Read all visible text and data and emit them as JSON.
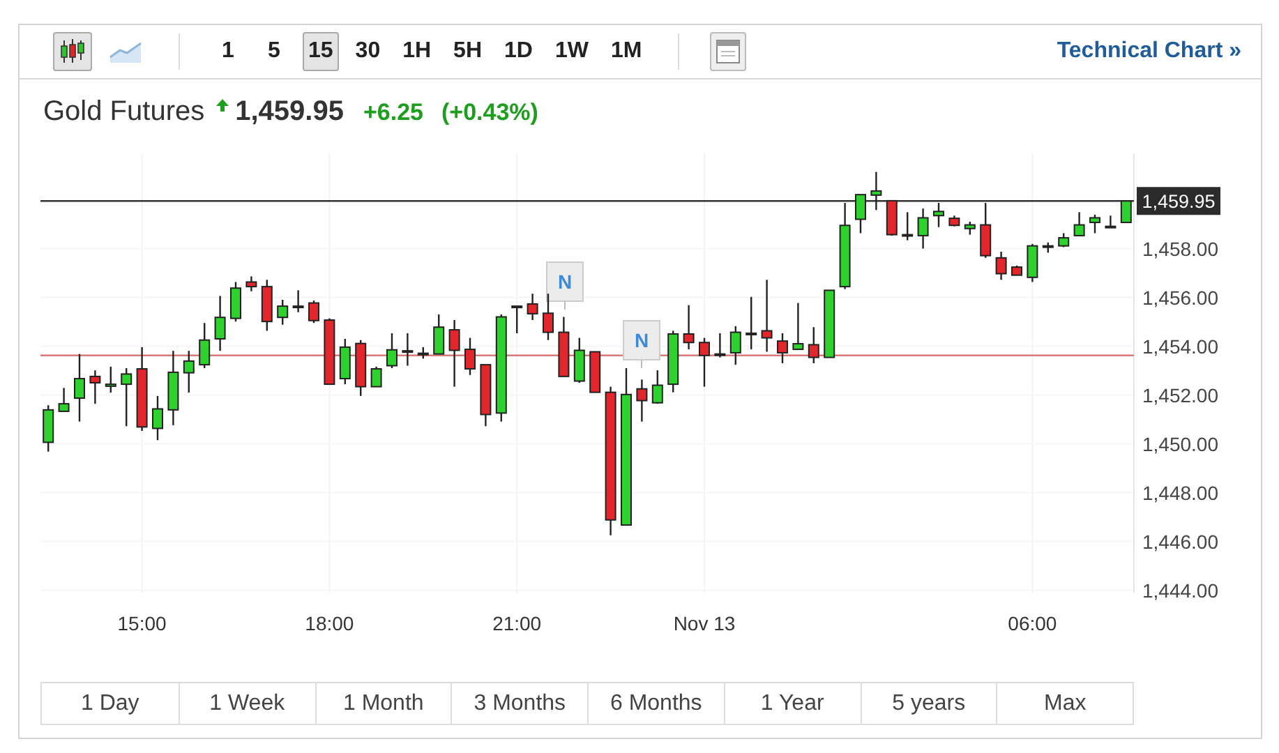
{
  "toolbar": {
    "chart_types": [
      {
        "kind": "candles",
        "selected": true
      },
      {
        "kind": "line",
        "selected": false
      }
    ],
    "intervals": [
      {
        "label": "1",
        "selected": false
      },
      {
        "label": "5",
        "selected": false
      },
      {
        "label": "15",
        "selected": true
      },
      {
        "label": "30",
        "selected": false
      },
      {
        "label": "1H",
        "selected": false
      },
      {
        "label": "5H",
        "selected": false
      },
      {
        "label": "1D",
        "selected": false
      },
      {
        "label": "1W",
        "selected": false
      },
      {
        "label": "1M",
        "selected": false
      }
    ],
    "link": "Technical Chart »"
  },
  "quote": {
    "name": "Gold Futures",
    "rising": true,
    "price": "1,459.95",
    "change": "+6.25",
    "change_pct": "(+0.43%)"
  },
  "chart": {
    "chart_data": {
      "type": "candlestick",
      "ylim": [
        1443.9,
        1461.9
      ],
      "categories": [
        null,
        null,
        null,
        null,
        null,
        null,
        "15:00",
        null,
        null,
        null,
        null,
        null,
        null,
        null,
        null,
        null,
        null,
        null,
        "18:00",
        null,
        null,
        null,
        null,
        null,
        null,
        null,
        null,
        null,
        null,
        null,
        "21:00",
        null,
        null,
        null,
        null,
        null,
        null,
        null,
        null,
        null,
        null,
        null,
        "Nov 13",
        null,
        null,
        null,
        null,
        null,
        null,
        null,
        null,
        null,
        null,
        null,
        null,
        null,
        null,
        null,
        null,
        null,
        null,
        null,
        null,
        "06:00",
        null,
        null,
        null,
        null,
        null,
        null
      ],
      "yticks": [
        {
          "value": 1444,
          "label": "1,444.00"
        },
        {
          "value": 1446,
          "label": "1,446.00"
        },
        {
          "value": 1448,
          "label": "1,448.00"
        },
        {
          "value": 1450,
          "label": "1,450.00"
        },
        {
          "value": 1452,
          "label": "1,452.00"
        },
        {
          "value": 1454,
          "label": "1,454.00"
        },
        {
          "value": 1456,
          "label": "1,456.00"
        },
        {
          "value": 1458,
          "label": "1,458.00"
        }
      ],
      "ohlc": [
        [
          1450.06,
          1451.58,
          1449.68,
          1451.39
        ],
        [
          1451.33,
          1452.29,
          1451.3,
          1451.64
        ],
        [
          1451.87,
          1453.68,
          1450.91,
          1452.67
        ],
        [
          1452.76,
          1453.01,
          1451.64,
          1452.5
        ],
        [
          1452.36,
          1453.16,
          1452.1,
          1452.44
        ],
        [
          1452.44,
          1453.1,
          1450.72,
          1452.86
        ],
        [
          1453.07,
          1453.96,
          1450.53,
          1450.69
        ],
        [
          1450.63,
          1451.96,
          1450.15,
          1451.43
        ],
        [
          1451.39,
          1453.81,
          1450.76,
          1452.93
        ],
        [
          1452.91,
          1453.81,
          1452.1,
          1453.39
        ],
        [
          1453.24,
          1454.95,
          1453.1,
          1454.25
        ],
        [
          1454.3,
          1456.06,
          1453.81,
          1455.18
        ],
        [
          1455.14,
          1456.63,
          1455.01,
          1456.38
        ],
        [
          1456.63,
          1456.86,
          1456.25,
          1456.44
        ],
        [
          1456.44,
          1456.72,
          1454.63,
          1455.01
        ],
        [
          1455.18,
          1455.9,
          1454.88,
          1455.64
        ],
        [
          1455.64,
          1456.29,
          1455.39,
          1455.64
        ],
        [
          1455.77,
          1455.87,
          1454.95,
          1455.05
        ],
        [
          1455.07,
          1455.14,
          1452.44,
          1452.44
        ],
        [
          1452.67,
          1454.3,
          1452.44,
          1453.96
        ],
        [
          1454.11,
          1454.25,
          1451.96,
          1452.34
        ],
        [
          1452.34,
          1453.16,
          1452.34,
          1453.07
        ],
        [
          1453.2,
          1454.53,
          1453.1,
          1453.85
        ],
        [
          1453.81,
          1454.53,
          1453.2,
          1453.81
        ],
        [
          1453.71,
          1453.96,
          1453.49,
          1453.71
        ],
        [
          1453.68,
          1455.3,
          1453.68,
          1454.78
        ],
        [
          1454.67,
          1455.07,
          1452.34,
          1453.83
        ],
        [
          1453.87,
          1454.34,
          1452.82,
          1453.07
        ],
        [
          1453.24,
          1453.24,
          1450.72,
          1451.2
        ],
        [
          1451.26,
          1455.3,
          1450.91,
          1455.2
        ],
        [
          1455.64,
          1455.64,
          1454.53,
          1455.64
        ],
        [
          1455.73,
          1456.15,
          1455.07,
          1455.33
        ],
        [
          1455.35,
          1456.15,
          1454.25,
          1454.57
        ],
        [
          1454.57,
          1455.2,
          1452.76,
          1452.76
        ],
        [
          1452.57,
          1454.34,
          1452.5,
          1453.83
        ],
        [
          1453.77,
          1453.77,
          1452.11,
          1452.11
        ],
        [
          1452.11,
          1452.34,
          1446.25,
          1446.88
        ],
        [
          1446.67,
          1453.1,
          1446.67,
          1452.02
        ],
        [
          1452.25,
          1452.63,
          1450.91,
          1451.77
        ],
        [
          1451.68,
          1453.01,
          1451.64,
          1452.4
        ],
        [
          1452.44,
          1454.63,
          1452.11,
          1454.5
        ],
        [
          1454.5,
          1455.68,
          1453.87,
          1454.15
        ],
        [
          1454.15,
          1454.34,
          1452.34,
          1453.62
        ],
        [
          1453.68,
          1454.53,
          1453.54,
          1453.68
        ],
        [
          1453.73,
          1454.82,
          1453.24,
          1454.57
        ],
        [
          1454.53,
          1456.02,
          1453.87,
          1454.53
        ],
        [
          1454.63,
          1456.72,
          1453.77,
          1454.34
        ],
        [
          1454.21,
          1454.53,
          1453.3,
          1453.73
        ],
        [
          1453.87,
          1455.77,
          1453.87,
          1454.1
        ],
        [
          1454.06,
          1454.78,
          1453.3,
          1453.54
        ],
        [
          1453.54,
          1456.29,
          1453.54,
          1456.29
        ],
        [
          1456.44,
          1459.87,
          1456.34,
          1458.95
        ],
        [
          1459.2,
          1460.21,
          1458.63,
          1460.21
        ],
        [
          1460.19,
          1461.14,
          1459.58,
          1460.36
        ],
        [
          1459.96,
          1459.96,
          1458.53,
          1458.57
        ],
        [
          1458.57,
          1459.49,
          1458.34,
          1458.57
        ],
        [
          1458.53,
          1459.64,
          1458.0,
          1459.26
        ],
        [
          1459.35,
          1459.87,
          1458.88,
          1459.52
        ],
        [
          1459.24,
          1459.35,
          1458.91,
          1458.95
        ],
        [
          1458.82,
          1459.1,
          1458.57,
          1458.97
        ],
        [
          1458.97,
          1459.87,
          1457.62,
          1457.71
        ],
        [
          1457.62,
          1457.87,
          1456.72,
          1456.97
        ],
        [
          1457.24,
          1457.3,
          1456.91,
          1456.91
        ],
        [
          1456.82,
          1458.19,
          1456.63,
          1458.11
        ],
        [
          1458.11,
          1458.25,
          1457.83,
          1458.11
        ],
        [
          1458.11,
          1458.63,
          1458.06,
          1458.44
        ],
        [
          1458.53,
          1459.49,
          1458.5,
          1458.97
        ],
        [
          1459.07,
          1459.39,
          1458.63,
          1459.26
        ],
        [
          1458.91,
          1459.35,
          1458.88,
          1458.91
        ],
        [
          1459.07,
          1459.95,
          1459.07,
          1459.95
        ]
      ],
      "grid": true,
      "ref_lines": [
        {
          "axis": "y",
          "value": 1459.95,
          "label": "1,459.95",
          "color": "#333333"
        },
        {
          "axis": "y",
          "value": 1453.62,
          "color": "#d97a7a"
        }
      ],
      "annotations": [
        "N",
        "N"
      ]
    }
  },
  "ranges": [
    {
      "label": "1 Day",
      "selected": false
    },
    {
      "label": "1 Week",
      "selected": false
    },
    {
      "label": "1 Month",
      "selected": false
    },
    {
      "label": "3 Months",
      "selected": false
    },
    {
      "label": "6 Months",
      "selected": false
    },
    {
      "label": "1 Year",
      "selected": false
    },
    {
      "label": "5 years",
      "selected": false
    },
    {
      "label": "Max",
      "selected": false
    }
  ]
}
